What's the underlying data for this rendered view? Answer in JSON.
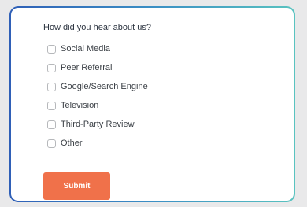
{
  "form": {
    "question": "How did you hear about us?",
    "options": [
      {
        "label": "Social Media",
        "checked": false
      },
      {
        "label": "Peer Referral",
        "checked": false
      },
      {
        "label": "Google/Search Engine",
        "checked": false
      },
      {
        "label": "Television",
        "checked": false
      },
      {
        "label": "Third-Party Review",
        "checked": false
      },
      {
        "label": "Other",
        "checked": false
      }
    ],
    "submit_label": "Submit"
  },
  "colors": {
    "page_background": "#e9e9ea",
    "card_border_start": "#2f5fb7",
    "card_border_end": "#59c3c0",
    "submit_background": "#f0714a",
    "submit_text": "#ffffff",
    "checkbox_border": "#b6b8bb"
  }
}
